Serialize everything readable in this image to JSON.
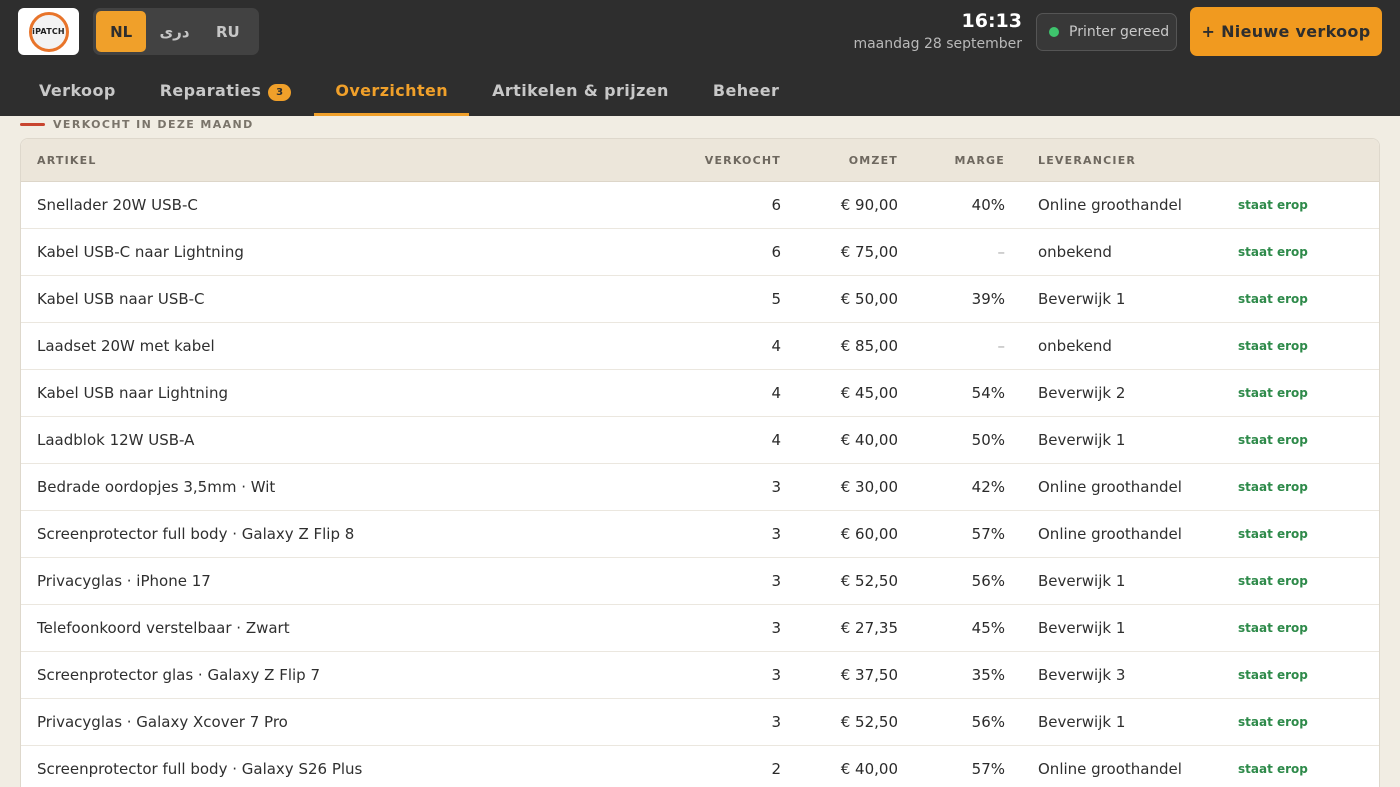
{
  "app": {
    "logo_text": "iPATCH",
    "languages": [
      "NL",
      "دری",
      "RU"
    ],
    "active_language": "NL",
    "time": "16:13",
    "date": "maandag 28 september",
    "printer_status": "Printer gereed",
    "new_sale_label": "+ Nieuwe verkoop",
    "status_color": "#3ec46d",
    "accent_color": "#f0a02a"
  },
  "tabs": [
    {
      "label": "Verkoop",
      "active": false
    },
    {
      "label": "Reparaties",
      "badge": "3",
      "active": false
    },
    {
      "label": "Overzichten",
      "active": true
    },
    {
      "label": "Artikelen & prijzen",
      "active": false
    },
    {
      "label": "Beheer",
      "active": false
    }
  ],
  "section": {
    "title": "VERKOCHT IN DEZE MAAND"
  },
  "table": {
    "headers": {
      "artikel": "ARTIKEL",
      "verkocht": "VERKOCHT",
      "omzet": "OMZET",
      "marge": "MARGE",
      "leverancier": "LEVERANCIER"
    },
    "rows": [
      {
        "artikel": "Snellader 20W USB-C",
        "verkocht": "6",
        "omzet": "€ 90,00",
        "marge": "40%",
        "leverancier": "Online groothandel",
        "status": "staat erop"
      },
      {
        "artikel": "Kabel USB-C naar Lightning",
        "verkocht": "6",
        "omzet": "€ 75,00",
        "marge": "–",
        "leverancier": "onbekend",
        "status": "staat erop"
      },
      {
        "artikel": "Kabel USB naar USB-C",
        "verkocht": "5",
        "omzet": "€ 50,00",
        "marge": "39%",
        "leverancier": "Beverwijk 1",
        "status": "staat erop"
      },
      {
        "artikel": "Laadset 20W met kabel",
        "verkocht": "4",
        "omzet": "€ 85,00",
        "marge": "–",
        "leverancier": "onbekend",
        "status": "staat erop"
      },
      {
        "artikel": "Kabel USB naar Lightning",
        "verkocht": "4",
        "omzet": "€ 45,00",
        "marge": "54%",
        "leverancier": "Beverwijk 2",
        "status": "staat erop"
      },
      {
        "artikel": "Laadblok 12W USB-A",
        "verkocht": "4",
        "omzet": "€ 40,00",
        "marge": "50%",
        "leverancier": "Beverwijk 1",
        "status": "staat erop"
      },
      {
        "artikel": "Bedrade oordopjes 3,5mm · Wit",
        "verkocht": "3",
        "omzet": "€ 30,00",
        "marge": "42%",
        "leverancier": "Online groothandel",
        "status": "staat erop"
      },
      {
        "artikel": "Screenprotector full body · Galaxy Z Flip 8",
        "verkocht": "3",
        "omzet": "€ 60,00",
        "marge": "57%",
        "leverancier": "Online groothandel",
        "status": "staat erop"
      },
      {
        "artikel": "Privacyglas · iPhone 17",
        "verkocht": "3",
        "omzet": "€ 52,50",
        "marge": "56%",
        "leverancier": "Beverwijk 1",
        "status": "staat erop"
      },
      {
        "artikel": "Telefoonkoord verstelbaar · Zwart",
        "verkocht": "3",
        "omzet": "€ 27,35",
        "marge": "45%",
        "leverancier": "Beverwijk 1",
        "status": "staat erop"
      },
      {
        "artikel": "Screenprotector glas · Galaxy Z Flip 7",
        "verkocht": "3",
        "omzet": "€ 37,50",
        "marge": "35%",
        "leverancier": "Beverwijk 3",
        "status": "staat erop"
      },
      {
        "artikel": "Privacyglas · Galaxy Xcover 7 Pro",
        "verkocht": "3",
        "omzet": "€ 52,50",
        "marge": "56%",
        "leverancier": "Beverwijk 1",
        "status": "staat erop"
      },
      {
        "artikel": "Screenprotector full body · Galaxy S26 Plus",
        "verkocht": "2",
        "omzet": "€ 40,00",
        "marge": "57%",
        "leverancier": "Online groothandel",
        "status": "staat erop"
      }
    ]
  }
}
